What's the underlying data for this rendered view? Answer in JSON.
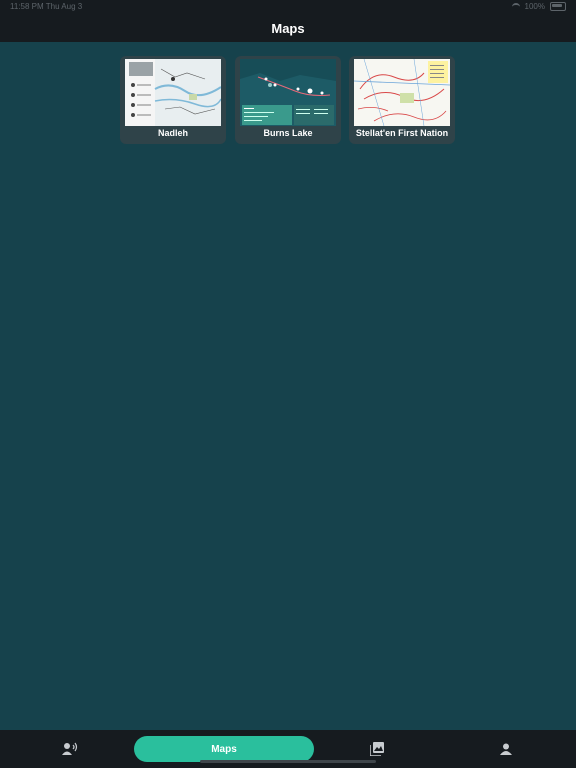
{
  "status_bar": {
    "time": "11:58 PM",
    "date": "Thu Aug 3",
    "battery": "100%"
  },
  "nav": {
    "title": "Maps"
  },
  "maps": [
    {
      "label": "Nadleh"
    },
    {
      "label": "Burns Lake"
    },
    {
      "label": "Stellat'en First Nation"
    }
  ],
  "tabs": {
    "speak_icon": "speaker-person-icon",
    "maps_label": "Maps",
    "gallery_icon": "photo-library-icon",
    "profile_icon": "person-icon"
  },
  "colors": {
    "background": "#16424c",
    "bars": "#161b1f",
    "card": "#2f4349",
    "accent": "#2abf9d"
  }
}
